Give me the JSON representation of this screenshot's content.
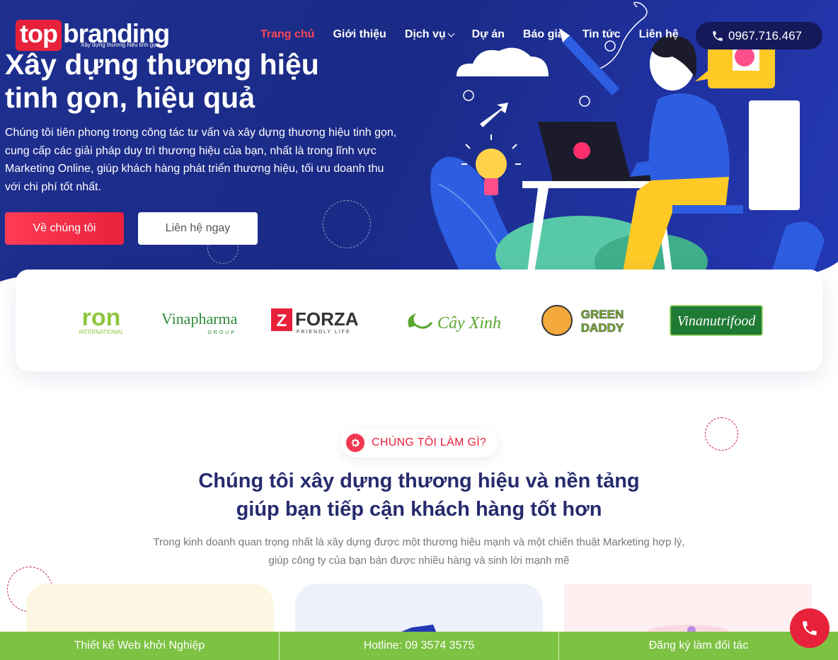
{
  "brand": {
    "logo_top": "top",
    "logo_brand": "branding",
    "logo_tagline": "Xây dựng thương hiệu tinh gọn"
  },
  "nav": {
    "items": [
      {
        "label": "Trang chủ",
        "active": true
      },
      {
        "label": "Giới thiệu"
      },
      {
        "label": "Dịch vụ",
        "dropdown": true
      },
      {
        "label": "Dự án"
      },
      {
        "label": "Báo giá"
      },
      {
        "label": "Tin tức"
      },
      {
        "label": "Liên hệ"
      }
    ],
    "phone": "0967.716.467"
  },
  "hero": {
    "title_line1": "Xây dựng thương hiệu",
    "title_line2": "tinh gọn, hiệu quả",
    "description": "Chúng tôi tiên phong trong công tác tư vấn và xây dựng thương hiệu tinh gọn, cung cấp các giải pháp duy trì thương hiệu của bạn, nhất là trong lĩnh vực Marketing Online, giúp khách hàng phát triển thương hiệu, tối ưu doanh thu với chi phí tốt nhất.",
    "primary_button": "Về chúng tôi",
    "secondary_button": "Liên hệ ngay"
  },
  "clients": [
    {
      "name": "ron",
      "sub": "INTERNATIONAL",
      "color": "#8cc63f"
    },
    {
      "name": "Vinapharma",
      "sub": "GROUP",
      "color": "#2e8b3a"
    },
    {
      "name": "FORZA",
      "sub": "FRIENDLY LIFE",
      "color": "#e8213b"
    },
    {
      "name": "Cây Xinh",
      "color": "#5aa832"
    },
    {
      "name": "GREEN DADDY",
      "color": "#7cb82f"
    },
    {
      "name": "Vinanutrifood",
      "color": "#1f7a34"
    }
  ],
  "services": {
    "badge": "CHÚNG TÔI LÀM GÌ?",
    "title_line1": "Chúng tôi xây dựng thương hiệu và nền tảng",
    "title_line2": "giúp bạn tiếp cận khách hàng tốt hơn",
    "desc_line1": "Trong kinh doanh quan trọng nhất là xây dựng được một thương hiệu mạnh và một chiến thuật Marketing hợp lý,",
    "desc_line2": "giúp công ty của bạn bán được nhiều hàng và sinh lời mạnh mẽ"
  },
  "bottom_bar": {
    "item1": "Thiết kế Web khởi Nghiệp",
    "item2": "Hotline: 09 3574 3575",
    "item3": "Đăng ký làm đối tác"
  },
  "colors": {
    "hero_bg": "#1e2f8f",
    "accent_red": "#e8213b",
    "heading_navy": "#262b6e",
    "bar_green": "#7dc242"
  },
  "icons": [
    "phone-icon",
    "chevron-down-icon",
    "gear-icon",
    "call-icon"
  ]
}
